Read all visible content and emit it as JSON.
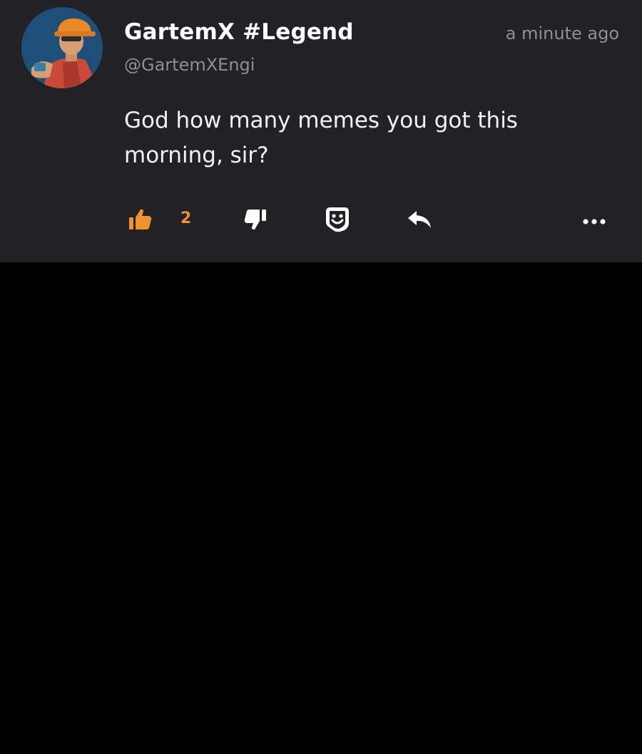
{
  "post": {
    "author": {
      "display_name": "GartemX #Legend",
      "handle": "@GartemXEngi",
      "avatar_icon": "engineer-avatar"
    },
    "timestamp": "a minute ago",
    "message": "God how many memes you got this morning, sir?",
    "actions": {
      "like": {
        "icon": "thumbs-up-icon",
        "count": "2",
        "active": true
      },
      "dislike": {
        "icon": "thumbs-down-icon"
      },
      "sticker": {
        "icon": "sticker-icon"
      },
      "reply": {
        "icon": "reply-icon"
      },
      "more": {
        "icon": "more-dots-icon"
      }
    }
  },
  "colors": {
    "card_background": "#222226",
    "page_background": "#000000",
    "accent": "#f0922b",
    "secondary_text": "#8e8e94",
    "primary_text": "#ffffff"
  }
}
